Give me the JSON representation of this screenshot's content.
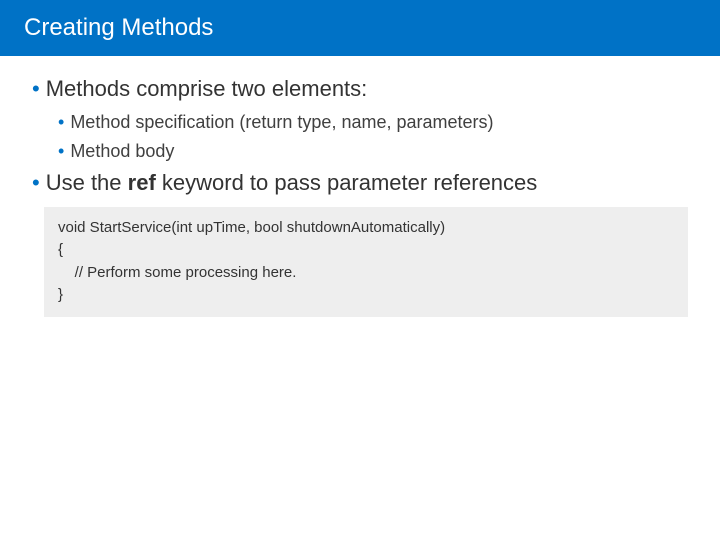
{
  "header": {
    "title": "Creating Methods"
  },
  "bullets": {
    "b1": "Methods comprise two elements:",
    "b1a": "Method specification (return type, name, parameters)",
    "b1b": "Method body",
    "b2_pre": "Use the ",
    "b2_bold": "ref",
    "b2_post": " keyword to pass parameter references"
  },
  "code": "void StartService(int upTime, bool shutdownAutomatically)\n{\n    // Perform some processing here.\n}"
}
